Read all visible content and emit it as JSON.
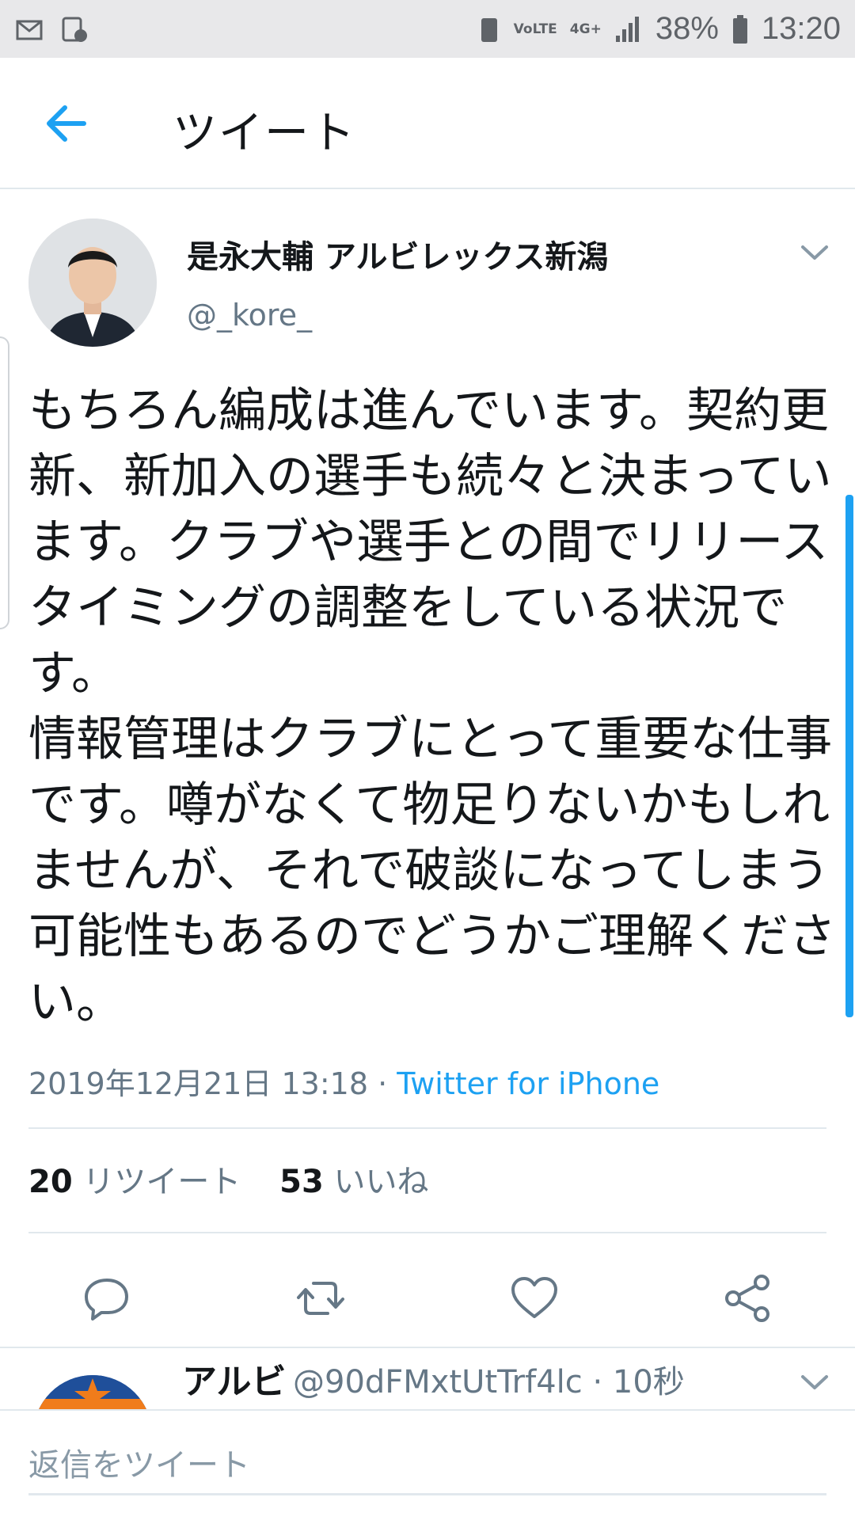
{
  "status_bar": {
    "battery": "38%",
    "time": "13:20",
    "network": "4G+",
    "volte": "VoLTE"
  },
  "header": {
    "title": "ツイート"
  },
  "tweet": {
    "display_name": "是永大輔 アルビレックス新潟",
    "handle": "@_kore_",
    "text": "もちろん編成は進んでいます。契約更新、新加入の選手も続々と決まっています。クラブや選手との間でリリースタイミングの調整をしている状況です。\n情報管理はクラブにとって重要な仕事です。噂がなくて物足りないかもしれませんが、それで破談になってしまう可能性もあるのでどうかご理解ください。",
    "timestamp": "2019年12月21日 13:18",
    "separator": " · ",
    "source": "Twitter for iPhone",
    "retweet_count": "20",
    "retweet_label": "リツイート",
    "like_count": "53",
    "like_label": "いいね"
  },
  "actions": {
    "reply": "reply-icon",
    "retweet": "retweet-icon",
    "like": "heart-icon",
    "share": "share-icon"
  },
  "reply_preview": {
    "name": "アルビ",
    "handle_time": "@90dFMxtUtTrf4lc · 10秒"
  },
  "compose": {
    "placeholder": "返信をツイート"
  },
  "colors": {
    "accent": "#1da1f2",
    "text": "#14171a",
    "secondary": "#657786",
    "divider": "#e1e8ed"
  }
}
